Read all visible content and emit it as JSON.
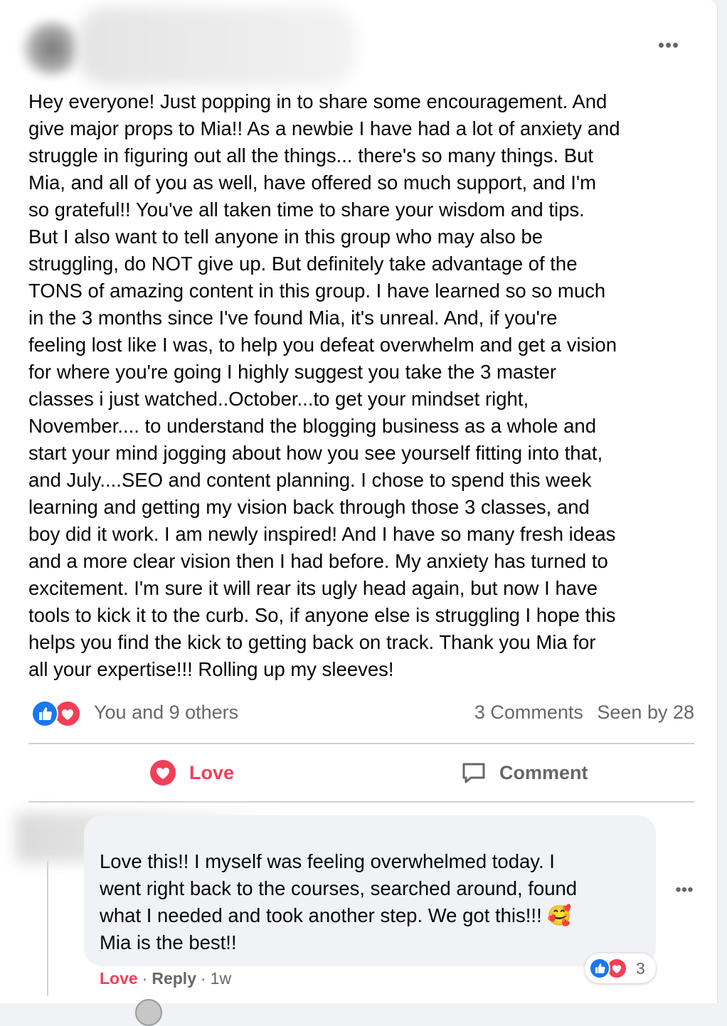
{
  "post": {
    "body": "Hey everyone! Just popping in to share some encouragement. And\ngive major props to Mia!! As a newbie I have had a lot of anxiety and\nstruggle in figuring out all the things... there's so many things.  But\nMia, and all of you as well,  have offered so much support, and I'm\nso grateful!! You've all taken time to share your wisdom and tips.\nBut I also want to tell anyone  in this group who may also be\nstruggling,  do NOT give up.  But definitely take advantage of the\nTONS of amazing content in this group.  I have learned so so much\nin the 3 months since I've found Mia, it's unreal. And, if you're\nfeeling lost like I was, to help you defeat overwhelm and get a vision\nfor where you're going  I highly suggest you take the 3 master\nclasses i just watched..October...to get your mindset right,\nNovember.... to understand the blogging business as a whole and\nstart your mind jogging about how you see yourself fitting into that,\nand July....SEO and content planning. I chose to spend this week\nlearning and getting my vision back through those 3 classes, and\nboy did it work.  I am newly inspired! And I have so many fresh ideas\nand a more clear vision then I had before. My anxiety has turned to\nexcitement.  I'm sure it will rear its ugly head again, but now I have\ntools to kick it to the curb. So, if anyone else is struggling I hope this\nhelps you find the kick to getting back on track. Thank you Mia for\nall your expertise!!! Rolling up my sleeves!",
    "more_icon": "more-horizontal-icon",
    "reactions_text": "You and 9 others",
    "comments_count": "3 Comments",
    "seen_by": "Seen by 28"
  },
  "actions": {
    "love_label": "Love",
    "comment_label": "Comment"
  },
  "comment": {
    "text": "Love this!! I myself was feeling overwhelmed today. I\nwent right back to the courses, searched around, found\nwhat I needed and took another step. We got this!!! 🥰\nMia is the best!!",
    "reaction_count": "3",
    "love_label": "Love",
    "reply_label": "Reply",
    "separator": "·",
    "time": "1w"
  },
  "colors": {
    "like_blue": "#1877f2",
    "love_red": "#f33e58",
    "secondary_text": "#65676b",
    "comment_bg": "#f0f2f5"
  }
}
